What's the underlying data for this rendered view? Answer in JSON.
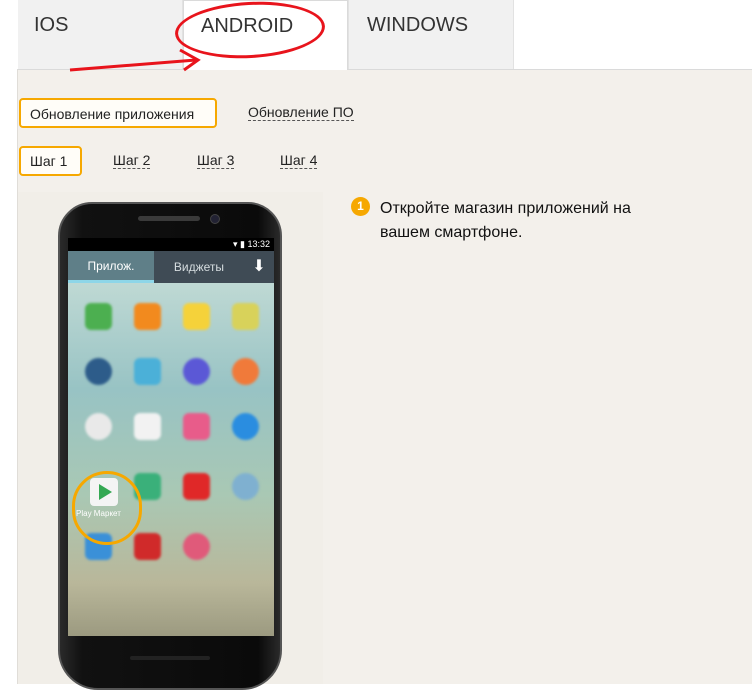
{
  "tabs": [
    {
      "label": "IOS"
    },
    {
      "label": "ANDROID"
    },
    {
      "label": "WINDOWS"
    }
  ],
  "subtabs": {
    "app_update": "Обновление приложения",
    "firmware_update": "Обновление ПО"
  },
  "steps": [
    "Шаг 1",
    "Шаг 2",
    "Шаг 3",
    "Шаг 4"
  ],
  "instruction": {
    "number": "1",
    "text": "Откройте магазин приложений на вашем смартфоне."
  },
  "phone": {
    "time": "13:32",
    "tab_apps": "Прилож.",
    "tab_widgets": "Виджеты",
    "download_icon": "download-icon",
    "play_label": "Play Маркет"
  },
  "colors": {
    "accent": "#f6a800",
    "annotation": "#e8141c"
  }
}
